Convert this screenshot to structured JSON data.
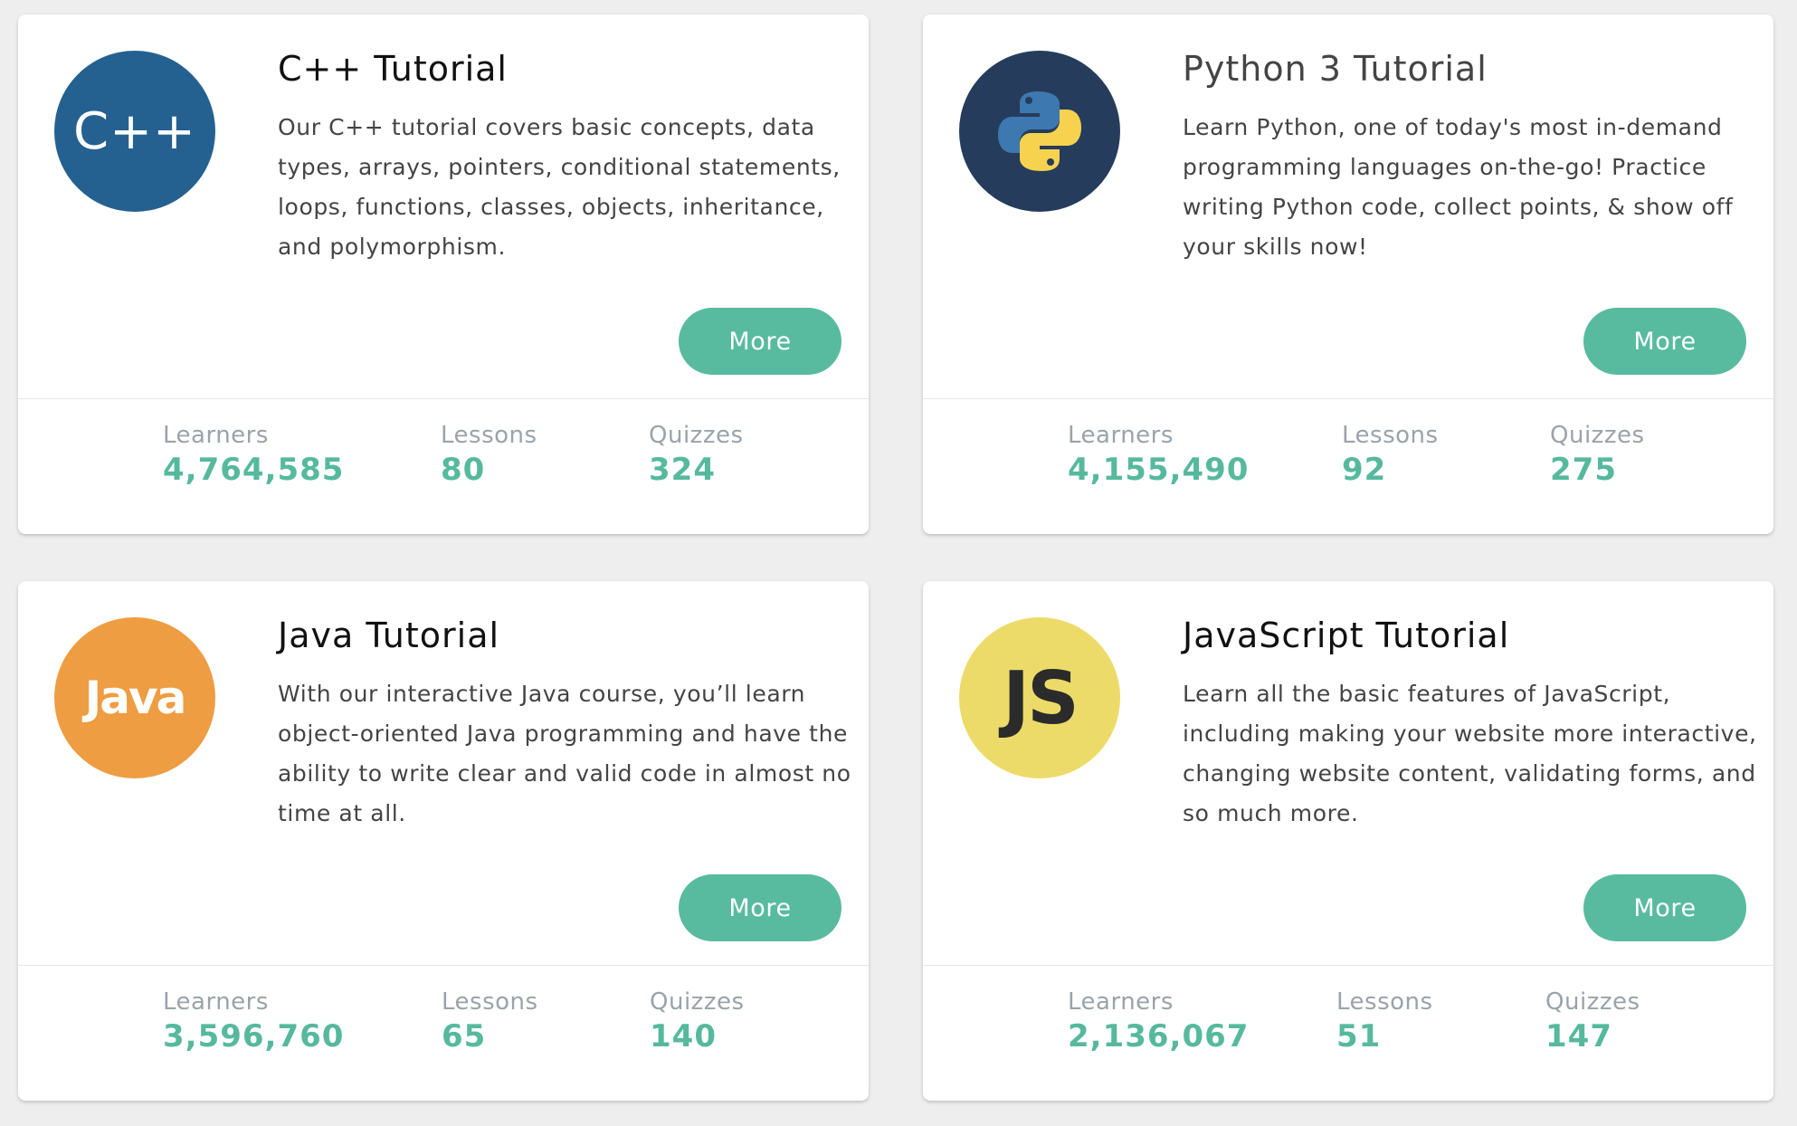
{
  "cards": [
    {
      "title": "C++ Tutorial",
      "description": "Our C++ tutorial covers basic concepts, data types, arrays, pointers, conditional statements, loops, functions, classes, objects, inheritance, and polymorphism.",
      "logo": {
        "icon": "cpp-logo-icon",
        "text": "C++",
        "color": "#256190"
      },
      "more_label": "More",
      "stats": [
        {
          "label": "Learners",
          "value": "4,764,585"
        },
        {
          "label": "Lessons",
          "value": "80"
        },
        {
          "label": "Quizzes",
          "value": "324"
        }
      ]
    },
    {
      "title": "Python 3 Tutorial",
      "description": "Learn Python, one of today's most in-demand programming languages on-the-go! Practice writing Python code, collect points, & show off your skills now!",
      "logo": {
        "icon": "python-logo-icon",
        "color": "#253c5c"
      },
      "more_label": "More",
      "stats": [
        {
          "label": "Learners",
          "value": "4,155,490"
        },
        {
          "label": "Lessons",
          "value": "92"
        },
        {
          "label": "Quizzes",
          "value": "275"
        }
      ]
    },
    {
      "title": "Java Tutorial",
      "description": "With our interactive Java course, you’ll learn object-oriented Java programming and have the ability to write clear and valid code in almost no time at all.",
      "logo": {
        "icon": "java-logo-icon",
        "text": "Java",
        "color": "#ee9d42"
      },
      "more_label": "More",
      "stats": [
        {
          "label": "Learners",
          "value": "3,596,760"
        },
        {
          "label": "Lessons",
          "value": "65"
        },
        {
          "label": "Quizzes",
          "value": "140"
        }
      ]
    },
    {
      "title": "JavaScript Tutorial",
      "description": "Learn all the basic features of JavaScript, including making your website more interactive, changing website content, validating forms, and so much more.",
      "logo": {
        "icon": "javascript-logo-icon",
        "text": "JS",
        "color": "#eddb69"
      },
      "more_label": "More",
      "stats": [
        {
          "label": "Learners",
          "value": "2,136,067"
        },
        {
          "label": "Lessons",
          "value": "51"
        },
        {
          "label": "Quizzes",
          "value": "147"
        }
      ]
    }
  ],
  "colors": {
    "accent": "#58bb9f",
    "stat_value": "#56b99e",
    "stat_label": "#9aa3ab",
    "background": "#eeeeee"
  }
}
